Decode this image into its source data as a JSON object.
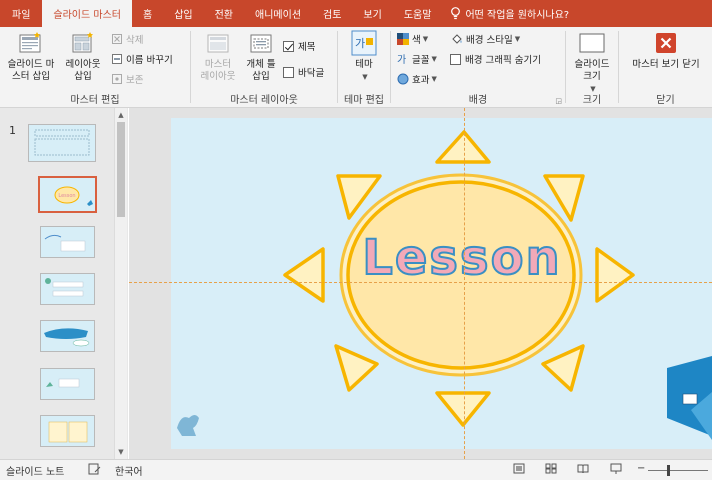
{
  "tabs": [
    {
      "label": "파일",
      "active": false
    },
    {
      "label": "슬라이드 마스터",
      "active": true
    },
    {
      "label": "홈",
      "active": false
    },
    {
      "label": "삽입",
      "active": false
    },
    {
      "label": "전환",
      "active": false
    },
    {
      "label": "애니메이션",
      "active": false
    },
    {
      "label": "검토",
      "active": false
    },
    {
      "label": "보기",
      "active": false
    },
    {
      "label": "도움말",
      "active": false
    }
  ],
  "tell_me": "어떤 작업을 원하시나요?",
  "groups": {
    "master_edit": {
      "label": "마스터 편집",
      "insert_slide_master": "슬라이드 마\n스터 삽입",
      "insert_layout": "레이아웃\n삽입",
      "delete": "삭제",
      "rename": "이름 바꾸기",
      "preserve": "보존"
    },
    "master_layout": {
      "label": "마스터 레이아웃",
      "master_layout_btn": "마스터\n레이아웃",
      "insert_placeholder": "개체 틀\n삽입",
      "title_check": "제목",
      "footer_check": "바닥글"
    },
    "edit_theme": {
      "label": "테마 편집",
      "themes": "테마"
    },
    "background": {
      "label": "배경",
      "colors": "색",
      "fonts": "글꼴",
      "effects": "효과",
      "bg_styles": "배경 스타일",
      "hide_bg_graphics": "배경 그래픽 숨기기"
    },
    "size": {
      "label": "크기",
      "slide_size": "슬라이드\n크기"
    },
    "close": {
      "label": "닫기",
      "close_master": "마스터 보기 닫기"
    }
  },
  "thumbnails": {
    "slide_number": "1",
    "items": [
      {
        "label": "",
        "selected": false
      },
      {
        "label": "Lesson",
        "selected": true
      },
      {
        "label": "",
        "selected": false
      },
      {
        "label": "",
        "selected": false
      },
      {
        "label": "",
        "selected": false
      },
      {
        "label": "",
        "selected": false
      },
      {
        "label": "",
        "selected": false
      }
    ]
  },
  "slide": {
    "title_text": "Lesson"
  },
  "status": {
    "view_name": "슬라이드 노트",
    "language": "한국어"
  },
  "colors": {
    "accent": "#c8472b",
    "sun_fill": "#ffe7a8",
    "sun_outline": "#f7b500",
    "slide_bg": "#d8eef8",
    "title_fill": "#f2a9b8",
    "title_outline": "#3a8fc4"
  }
}
